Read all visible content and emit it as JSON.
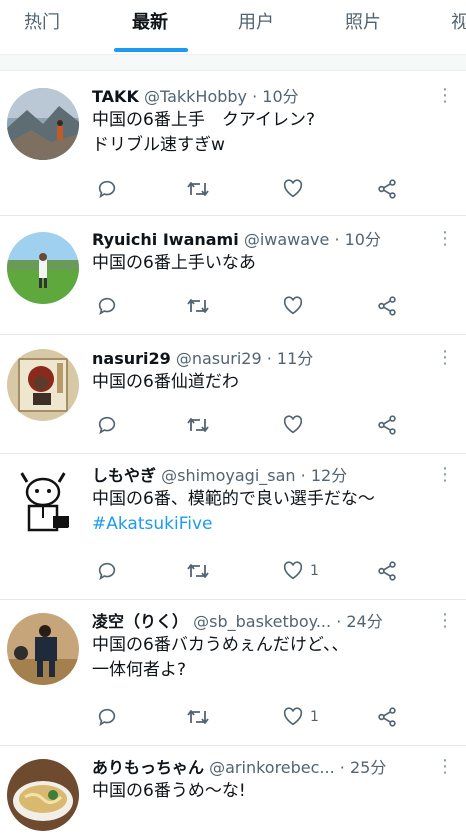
{
  "tabs": [
    {
      "label": "热门"
    },
    {
      "label": "最新"
    },
    {
      "label": "用户"
    },
    {
      "label": "照片"
    },
    {
      "label": "视"
    }
  ],
  "active_tab": "最新",
  "colors": {
    "accent": "#1d9bf0",
    "text": "#0f1419",
    "muted": "#536471"
  },
  "tweets": [
    {
      "name": "TAKK",
      "handle": "@TakkHobby",
      "time": "· 10分",
      "lines": [
        "中国の6番上手　クアイレン?",
        "ドリブル速すぎw"
      ],
      "like_count": "",
      "avatar": "mountain-photo"
    },
    {
      "name": "Ryuichi Iwanami",
      "handle": "@iwawave",
      "time": "· 10分",
      "lines": [
        "中国の6番上手いなあ"
      ],
      "like_count": "",
      "avatar": "field-photo"
    },
    {
      "name": "nasuri29",
      "handle": "@nasuri29",
      "time": "· 11分",
      "lines": [
        "中国の6番仙道だわ"
      ],
      "like_count": "",
      "avatar": "album-photo"
    },
    {
      "name": "しもやぎ",
      "handle": "@shimoyagi_san",
      "time": "· 12分",
      "lines": [
        "中国の6番、模範的で良い選手だな〜"
      ],
      "hashtag": "#AkatsukiFive",
      "like_count": "1",
      "avatar": "goat-illustration"
    },
    {
      "name": "凌空（りく）",
      "handle": "@sb_basketboy...",
      "time": "· 24分",
      "lines": [
        "中国の6番バカうめぇんだけど、、",
        "一体何者よ?"
      ],
      "like_count": "1",
      "avatar": "basketball-photo"
    },
    {
      "name": "ありもっちゃん",
      "handle": "@arinkorebec...",
      "time": "· 25分",
      "lines": [
        "中国の6番うめ〜な!"
      ],
      "like_count": "",
      "avatar": "ramen-photo"
    }
  ]
}
